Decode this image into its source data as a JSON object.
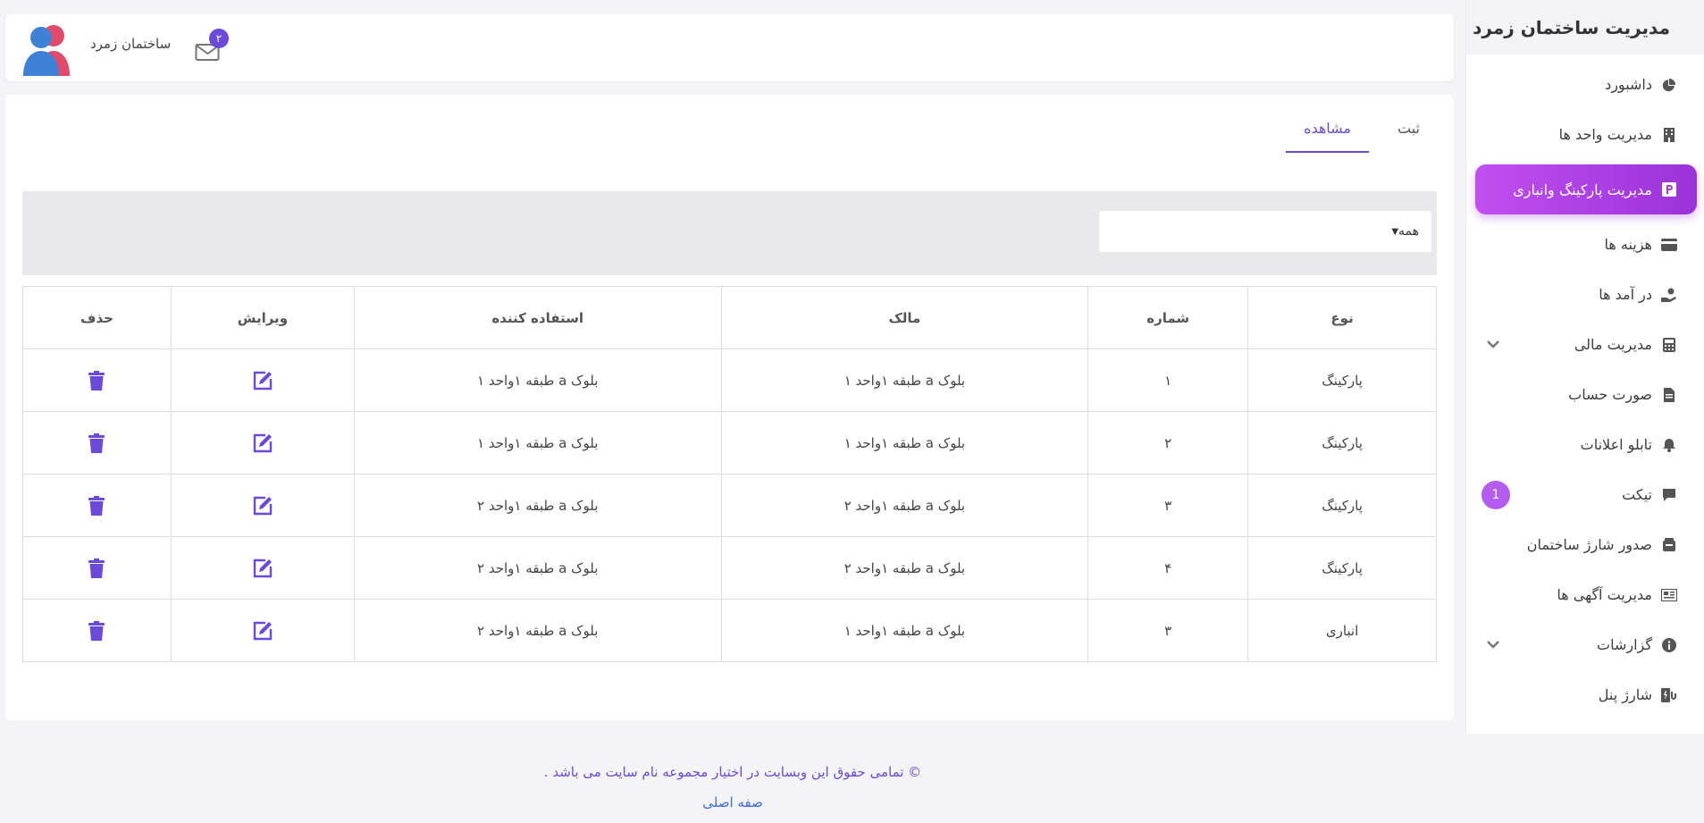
{
  "sidebar": {
    "title": "مدیریت ساختمان زمرد",
    "items": [
      {
        "label": "داشبورد",
        "icon": "pie-chart-icon",
        "active": false
      },
      {
        "label": "مدیریت واحد ها",
        "icon": "building-icon",
        "active": false
      },
      {
        "label": "مدیریت پارکینگ وانباری",
        "icon": "parking-icon",
        "active": true
      },
      {
        "label": "هزینه ها",
        "icon": "credit-card-icon",
        "active": false
      },
      {
        "label": "در آمد ها",
        "icon": "hand-coin-icon",
        "active": false
      },
      {
        "label": "مدیریت مالی",
        "icon": "calculator-icon",
        "active": false,
        "expandable": true
      },
      {
        "label": "صورت حساب",
        "icon": "document-icon",
        "active": false
      },
      {
        "label": "تابلو اعلانات",
        "icon": "bell-icon",
        "active": false
      },
      {
        "label": "تیکت",
        "icon": "chat-icon",
        "active": false,
        "badge": "1"
      },
      {
        "label": "صدور شارژ ساختمان",
        "icon": "wallet-icon",
        "active": false
      },
      {
        "label": "مدیریت آگهی ها",
        "icon": "newspaper-icon",
        "active": false
      },
      {
        "label": "گزارشات",
        "icon": "info-icon",
        "active": false,
        "expandable": true
      },
      {
        "label": "شارژ پنل",
        "icon": "charge-icon",
        "active": false
      }
    ]
  },
  "header": {
    "building_name": "ساختمان زمرد",
    "mail_count": "۲"
  },
  "tabs": [
    {
      "label": "ثبت",
      "active": false
    },
    {
      "label": "مشاهده",
      "active": true
    }
  ],
  "filter": {
    "selected": "همه"
  },
  "table": {
    "headers": [
      "نوع",
      "شماره",
      "مالک",
      "استفاده کننده",
      "ویرایش",
      "حذف"
    ],
    "rows": [
      {
        "type": "پارکینگ",
        "number": "۱",
        "owner": "بلوک a طبقه ۱واحد ۱",
        "user": "بلوک a طبقه ۱واحد ۱"
      },
      {
        "type": "پارکینگ",
        "number": "۲",
        "owner": "بلوک a طبقه ۱واحد ۱",
        "user": "بلوک a طبقه ۱واحد ۱"
      },
      {
        "type": "پارکینگ",
        "number": "۳",
        "owner": "بلوک a طبقه ۱واحد ۲",
        "user": "بلوک a طبقه ۱واحد ۲"
      },
      {
        "type": "پارکینگ",
        "number": "۴",
        "owner": "بلوک a طبقه ۱واحد ۲",
        "user": "بلوک a طبقه ۱واحد ۲"
      },
      {
        "type": "انباری",
        "number": "۳",
        "owner": "بلوک a طبقه ۱واحد ۱",
        "user": "بلوک a طبقه ۱واحد ۲"
      }
    ]
  },
  "footer": {
    "copyright": "© تمامی حقوق این وبسایت در اختیار مجموعه نام سایت می باشد .",
    "home_link": "صفه اصلی"
  },
  "colors": {
    "accent": "#6a4bd9",
    "active_gradient_start": "#c14ff0",
    "active_gradient_end": "#9a33d8",
    "link": "#3d6be8"
  }
}
